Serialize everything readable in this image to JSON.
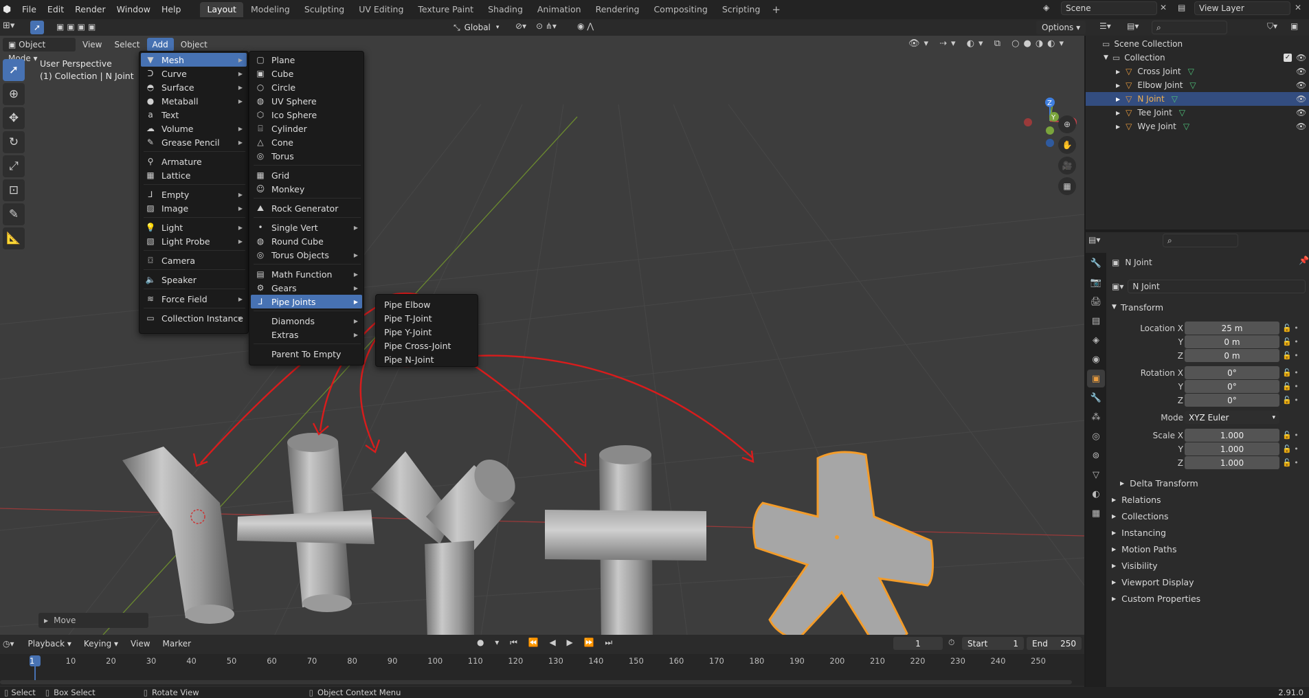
{
  "topbar": {
    "menus": [
      "File",
      "Edit",
      "Render",
      "Window",
      "Help"
    ],
    "workspaces": [
      "Layout",
      "Modeling",
      "Sculpting",
      "UV Editing",
      "Texture Paint",
      "Shading",
      "Animation",
      "Rendering",
      "Compositing",
      "Scripting"
    ],
    "active_workspace": "Layout",
    "scene_name": "Scene",
    "view_layer": "View Layer"
  },
  "viewport_header": {
    "mode": "Object Mode",
    "menus": [
      "View",
      "Select",
      "Add",
      "Object"
    ],
    "transform_orientation": "Global",
    "options_label": "Options"
  },
  "viewport": {
    "perspective_label": "User Perspective",
    "collection_label": "(1) Collection | N Joint",
    "last_operation": "Move",
    "gizmo_axes": [
      "X",
      "Y",
      "Z"
    ]
  },
  "add_menu": {
    "items": [
      {
        "label": "Mesh",
        "icon": "mesh-icon",
        "highlighted": true
      },
      {
        "label": "Curve",
        "icon": "curve-icon"
      },
      {
        "label": "Surface",
        "icon": "surface-icon"
      },
      {
        "label": "Metaball",
        "icon": "metaball-icon"
      },
      {
        "label": "Text",
        "icon": "text-icon"
      },
      {
        "label": "Volume",
        "icon": "volume-icon"
      },
      {
        "label": "Grease Pencil",
        "icon": "grease-pencil-icon"
      },
      {
        "label": "Armature",
        "icon": "armature-icon"
      },
      {
        "label": "Lattice",
        "icon": "lattice-icon"
      },
      {
        "label": "Empty",
        "icon": "empty-icon"
      },
      {
        "label": "Image",
        "icon": "image-icon"
      },
      {
        "label": "Light",
        "icon": "light-icon"
      },
      {
        "label": "Light Probe",
        "icon": "light-probe-icon"
      },
      {
        "label": "Camera",
        "icon": "camera-icon"
      },
      {
        "label": "Speaker",
        "icon": "speaker-icon"
      },
      {
        "label": "Force Field",
        "icon": "force-field-icon"
      },
      {
        "label": "Collection Instance",
        "icon": "collection-instance-icon"
      }
    ]
  },
  "mesh_menu": {
    "items": [
      "Plane",
      "Cube",
      "Circle",
      "UV Sphere",
      "Ico Sphere",
      "Cylinder",
      "Cone",
      "Torus",
      "Grid",
      "Monkey",
      "Rock Generator",
      "Single Vert",
      "Round Cube",
      "Torus Objects",
      "Math Function",
      "Gears",
      "Pipe Joints",
      "Diamonds",
      "Extras",
      "Parent To Empty"
    ],
    "highlighted": "Pipe Joints"
  },
  "pipe_joints_menu": {
    "items": [
      "Pipe Elbow",
      "Pipe T-Joint",
      "Pipe Y-Joint",
      "Pipe Cross-Joint",
      "Pipe N-Joint"
    ]
  },
  "outliner": {
    "root": "Scene Collection",
    "collection": "Collection",
    "objects": [
      "Cross Joint",
      "Elbow Joint",
      "N Joint",
      "Tee Joint",
      "Wye Joint"
    ],
    "selected": "N Joint"
  },
  "properties": {
    "object_name": "N Joint",
    "data_name": "N Joint",
    "transform_header": "Transform",
    "location": {
      "label": "Location X",
      "x": "25 m",
      "y": "0 m",
      "z": "0 m"
    },
    "rotation": {
      "label": "Rotation X",
      "x": "0°",
      "y": "0°",
      "z": "0°"
    },
    "mode_label": "Mode",
    "mode_value": "XYZ Euler",
    "scale": {
      "label": "Scale X",
      "x": "1.000",
      "y": "1.000",
      "z": "1.000"
    },
    "axis_y": "Y",
    "axis_z": "Z",
    "subpanels": [
      "Delta Transform",
      "Relations",
      "Collections",
      "Instancing",
      "Motion Paths",
      "Visibility",
      "Viewport Display",
      "Custom Properties"
    ]
  },
  "timeline": {
    "menus": [
      "Playback",
      "Keying",
      "View",
      "Marker"
    ],
    "current_frame": "1",
    "start_label": "Start",
    "start": "1",
    "end_label": "End",
    "end": "250",
    "ticks": [
      "1",
      "10",
      "20",
      "30",
      "40",
      "50",
      "60",
      "70",
      "80",
      "90",
      "100",
      "110",
      "120",
      "130",
      "140",
      "150",
      "160",
      "170",
      "180",
      "190",
      "200",
      "210",
      "220",
      "230",
      "240",
      "250"
    ]
  },
  "statusbar": {
    "select": "Select",
    "box_select": "Box Select",
    "rotate_view": "Rotate View",
    "context_menu": "Object Context Menu",
    "version": "2.91.0"
  },
  "colors": {
    "accent": "#4772b3",
    "selection_outline": "#f39c2a",
    "annotation": "#d91c1c",
    "x_axis": "#c9424c",
    "y_axis": "#7aa43c",
    "z_axis": "#3f7fe0"
  }
}
